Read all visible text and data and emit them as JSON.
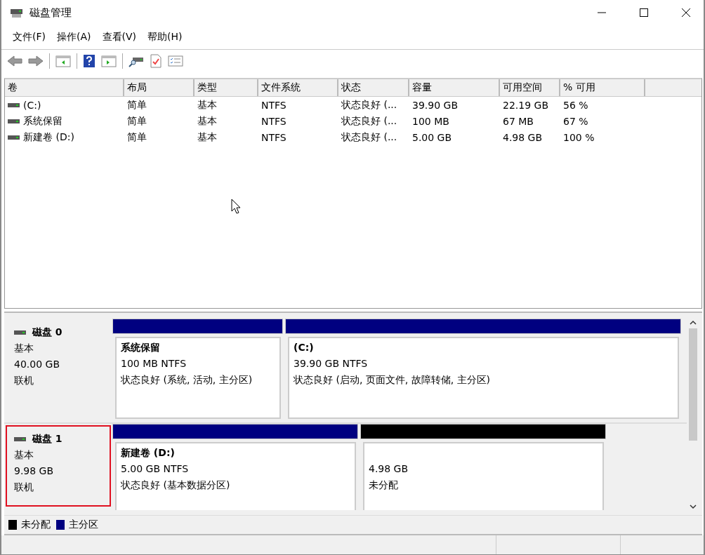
{
  "window": {
    "title": "磁盘管理"
  },
  "menu": [
    "文件(F)",
    "操作(A)",
    "查看(V)",
    "帮助(H)"
  ],
  "volume_table": {
    "columns": [
      "卷",
      "布局",
      "类型",
      "文件系统",
      "状态",
      "容量",
      "可用空间",
      "% 可用"
    ],
    "rows": [
      [
        "(C:)",
        "简单",
        "基本",
        "NTFS",
        "状态良好 (...",
        "39.90 GB",
        "22.19 GB",
        "56 %"
      ],
      [
        "系统保留",
        "简单",
        "基本",
        "NTFS",
        "状态良好 (...",
        "100 MB",
        "67 MB",
        "67 %"
      ],
      [
        "新建卷 (D:)",
        "简单",
        "基本",
        "NTFS",
        "状态良好 (...",
        "5.00 GB",
        "4.98 GB",
        "100 %"
      ]
    ]
  },
  "disks": [
    {
      "name": "磁盘 0",
      "type": "基本",
      "size": "40.00 GB",
      "status": "联机",
      "selected": false,
      "partitions": [
        {
          "kind": "primary",
          "name": "系统保留",
          "size": "100 MB NTFS",
          "status": "状态良好 (系统, 活动, 主分区)"
        },
        {
          "kind": "primary",
          "name": "(C:)",
          "size": "39.90 GB NTFS",
          "status": "状态良好 (启动, 页面文件, 故障转储, 主分区)"
        }
      ]
    },
    {
      "name": "磁盘 1",
      "type": "基本",
      "size": "9.98 GB",
      "status": "联机",
      "selected": true,
      "partitions": [
        {
          "kind": "primary",
          "name": "新建卷 (D:)",
          "size": "5.00 GB NTFS",
          "status": "状态良好 (基本数据分区)"
        },
        {
          "kind": "unallocated",
          "size": "4.98 GB",
          "status": "未分配"
        }
      ]
    }
  ],
  "legend": [
    {
      "label": "未分配",
      "color": "#000000"
    },
    {
      "label": "主分区",
      "color": "#000080"
    }
  ]
}
